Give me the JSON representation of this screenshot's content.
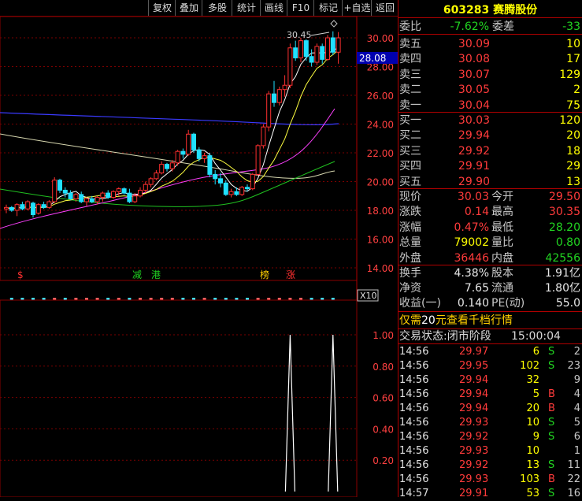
{
  "toolbar": [
    "复权",
    "叠加",
    "多股",
    "统计",
    "画线",
    "F10",
    "标记",
    "+自选",
    "返回"
  ],
  "stock": {
    "code": "603283",
    "name": "赛腾股份"
  },
  "weibi": {
    "label": "委比",
    "value": "-7.62%",
    "label2": "委差",
    "value2": "-33"
  },
  "sell": [
    {
      "label": "卖五",
      "price": "30.09",
      "vol": "10"
    },
    {
      "label": "卖四",
      "price": "30.08",
      "vol": "17"
    },
    {
      "label": "卖三",
      "price": "30.07",
      "vol": "129"
    },
    {
      "label": "卖二",
      "price": "30.05",
      "vol": "2"
    },
    {
      "label": "卖一",
      "price": "30.04",
      "vol": "75"
    }
  ],
  "buy": [
    {
      "label": "买一",
      "price": "30.03",
      "vol": "120"
    },
    {
      "label": "买二",
      "price": "29.94",
      "vol": "20"
    },
    {
      "label": "买三",
      "price": "29.92",
      "vol": "18"
    },
    {
      "label": "买四",
      "price": "29.91",
      "vol": "29"
    },
    {
      "label": "买五",
      "price": "29.90",
      "vol": "13"
    }
  ],
  "quote": [
    {
      "l1": "现价",
      "v1": "30.03",
      "l2": "今开",
      "v2": "29.50",
      "c1": "red",
      "c2": "red"
    },
    {
      "l1": "涨跌",
      "v1": "0.14",
      "l2": "最高",
      "v2": "30.35",
      "c1": "red",
      "c2": "red"
    },
    {
      "l1": "涨幅",
      "v1": "0.47%",
      "l2": "最低",
      "v2": "28.20",
      "c1": "red",
      "c2": "grn"
    },
    {
      "l1": "总量",
      "v1": "79002",
      "l2": "量比",
      "v2": "0.80",
      "c1": "yel",
      "c2": "grn"
    },
    {
      "l1": "外盘",
      "v1": "36446",
      "l2": "内盘",
      "v2": "42556",
      "c1": "red",
      "c2": "grn"
    }
  ],
  "fund": [
    {
      "l1": "换手",
      "v1": "4.38%",
      "l2": "股本",
      "v2": "1.91亿"
    },
    {
      "l1": "净资",
      "v1": "7.65",
      "l2": "流通",
      "v2": "1.80亿"
    },
    {
      "l1": "收益(一)",
      "v1": "0.140",
      "l2": "PE(动)",
      "v2": "55.0"
    }
  ],
  "promo": {
    "pre": "仅需",
    "num": "20",
    "post": "元查看千档行情"
  },
  "status": {
    "label": "交易状态:",
    "value": "闭市阶段",
    "time": "15:00:04"
  },
  "ticks": [
    {
      "t": "14:56",
      "p": "29.97",
      "v": "6",
      "bs": "S",
      "n": "2"
    },
    {
      "t": "14:56",
      "p": "29.95",
      "v": "102",
      "bs": "S",
      "n": "23"
    },
    {
      "t": "14:56",
      "p": "29.94",
      "v": "32",
      "bs": "",
      "n": "9"
    },
    {
      "t": "14:56",
      "p": "29.94",
      "v": "5",
      "bs": "B",
      "n": "4"
    },
    {
      "t": "14:56",
      "p": "29.94",
      "v": "20",
      "bs": "B",
      "n": "4"
    },
    {
      "t": "14:56",
      "p": "29.93",
      "v": "10",
      "bs": "S",
      "n": "5"
    },
    {
      "t": "14:56",
      "p": "29.92",
      "v": "9",
      "bs": "S",
      "n": "6"
    },
    {
      "t": "14:56",
      "p": "29.93",
      "v": "10",
      "bs": "",
      "n": "1"
    },
    {
      "t": "14:56",
      "p": "29.92",
      "v": "13",
      "bs": "S",
      "n": "11"
    },
    {
      "t": "14:56",
      "p": "29.93",
      "v": "103",
      "bs": "B",
      "n": "22"
    },
    {
      "t": "14:57",
      "p": "29.91",
      "v": "53",
      "bs": "S",
      "n": "16"
    }
  ],
  "chart_data": [
    {
      "type": "candlestick",
      "y_ticks": [
        "30.00",
        "28.00",
        "26.00",
        "24.00",
        "22.00",
        "20.00",
        "18.00",
        "16.00",
        "14.00"
      ],
      "ylim": [
        14,
        30
      ],
      "current_price_label": "28.08",
      "high_annotation": "30.45",
      "marker_labels": [
        "$",
        "减",
        "港",
        "榜",
        "涨"
      ],
      "candles": [
        [
          18.1,
          18.4,
          17.8,
          18.2
        ],
        [
          18.2,
          18.3,
          17.9,
          18.0
        ],
        [
          18.0,
          18.5,
          17.6,
          18.4
        ],
        [
          18.4,
          18.6,
          18.0,
          18.1
        ],
        [
          18.1,
          18.7,
          18.0,
          18.6
        ],
        [
          18.5,
          18.6,
          17.5,
          17.7
        ],
        [
          17.8,
          18.5,
          17.7,
          18.4
        ],
        [
          18.4,
          18.6,
          18.1,
          18.2
        ],
        [
          18.2,
          18.7,
          18.1,
          18.6
        ],
        [
          18.6,
          20.3,
          18.5,
          20.1
        ],
        [
          20.1,
          20.2,
          19.2,
          19.4
        ],
        [
          19.4,
          19.6,
          18.9,
          19.2
        ],
        [
          19.2,
          19.4,
          18.7,
          18.8
        ],
        [
          18.8,
          19.2,
          18.6,
          19.1
        ],
        [
          19.1,
          19.3,
          18.5,
          18.6
        ],
        [
          18.6,
          18.9,
          18.3,
          18.8
        ],
        [
          18.8,
          19.0,
          18.5,
          18.6
        ],
        [
          18.6,
          19.0,
          18.4,
          18.9
        ],
        [
          18.9,
          19.3,
          18.6,
          19.2
        ],
        [
          19.2,
          19.4,
          18.8,
          18.9
        ],
        [
          18.9,
          19.4,
          18.8,
          19.3
        ],
        [
          19.3,
          19.6,
          19.0,
          19.5
        ],
        [
          19.5,
          19.6,
          19.1,
          19.2
        ],
        [
          19.2,
          19.5,
          18.5,
          18.6
        ],
        [
          18.6,
          19.2,
          18.5,
          19.0
        ],
        [
          19.0,
          19.6,
          18.9,
          19.4
        ],
        [
          19.4,
          20.0,
          19.2,
          19.8
        ],
        [
          19.8,
          20.3,
          19.6,
          20.2
        ],
        [
          20.2,
          20.8,
          20.1,
          20.6
        ],
        [
          20.6,
          21.4,
          20.5,
          21.2
        ],
        [
          21.2,
          21.3,
          20.7,
          20.9
        ],
        [
          20.9,
          21.5,
          20.7,
          21.3
        ],
        [
          21.3,
          22.2,
          21.1,
          22.1
        ],
        [
          22.1,
          22.3,
          21.6,
          21.9
        ],
        [
          21.9,
          23.6,
          21.8,
          23.3
        ],
        [
          23.3,
          23.4,
          22.0,
          22.2
        ],
        [
          22.2,
          22.4,
          21.4,
          21.6
        ],
        [
          21.6,
          22.0,
          21.3,
          21.8
        ],
        [
          21.8,
          22.0,
          20.3,
          20.5
        ],
        [
          20.5,
          20.8,
          19.8,
          20.2
        ],
        [
          20.2,
          20.6,
          19.6,
          19.9
        ],
        [
          19.9,
          20.1,
          19.0,
          19.1
        ],
        [
          19.1,
          19.5,
          18.9,
          19.3
        ],
        [
          19.3,
          19.6,
          19.0,
          19.1
        ],
        [
          19.1,
          19.7,
          19.0,
          19.6
        ],
        [
          19.6,
          19.8,
          19.3,
          19.5
        ],
        [
          19.5,
          20.6,
          19.4,
          20.5
        ],
        [
          20.5,
          22.6,
          20.4,
          22.5
        ],
        [
          22.5,
          24.0,
          22.3,
          23.8
        ],
        [
          23.8,
          26.3,
          23.5,
          26.1
        ],
        [
          26.1,
          27.0,
          25.2,
          25.5
        ],
        [
          25.5,
          26.6,
          25.3,
          26.4
        ],
        [
          26.4,
          27.4,
          25.9,
          26.7
        ],
        [
          26.7,
          29.6,
          26.5,
          29.3
        ],
        [
          29.3,
          29.8,
          28.4,
          28.6
        ],
        [
          28.6,
          30.0,
          28.3,
          29.8
        ],
        [
          29.8,
          29.9,
          28.4,
          28.7
        ],
        [
          28.7,
          29.2,
          28.0,
          28.3
        ],
        [
          28.3,
          29.6,
          28.1,
          29.4
        ],
        [
          29.4,
          29.6,
          28.2,
          28.5
        ],
        [
          28.5,
          30.2,
          28.4,
          30.0
        ],
        [
          30.0,
          30.45,
          28.8,
          29.0
        ],
        [
          29.0,
          30.4,
          28.2,
          30.0
        ]
      ]
    },
    {
      "type": "line",
      "y_ticks": [
        "1.00",
        "0.80",
        "0.60",
        "0.40",
        "0.20"
      ],
      "ylim": [
        0,
        1.1
      ],
      "indicator_label": "X10",
      "signal_positions": [
        53,
        61
      ]
    }
  ]
}
